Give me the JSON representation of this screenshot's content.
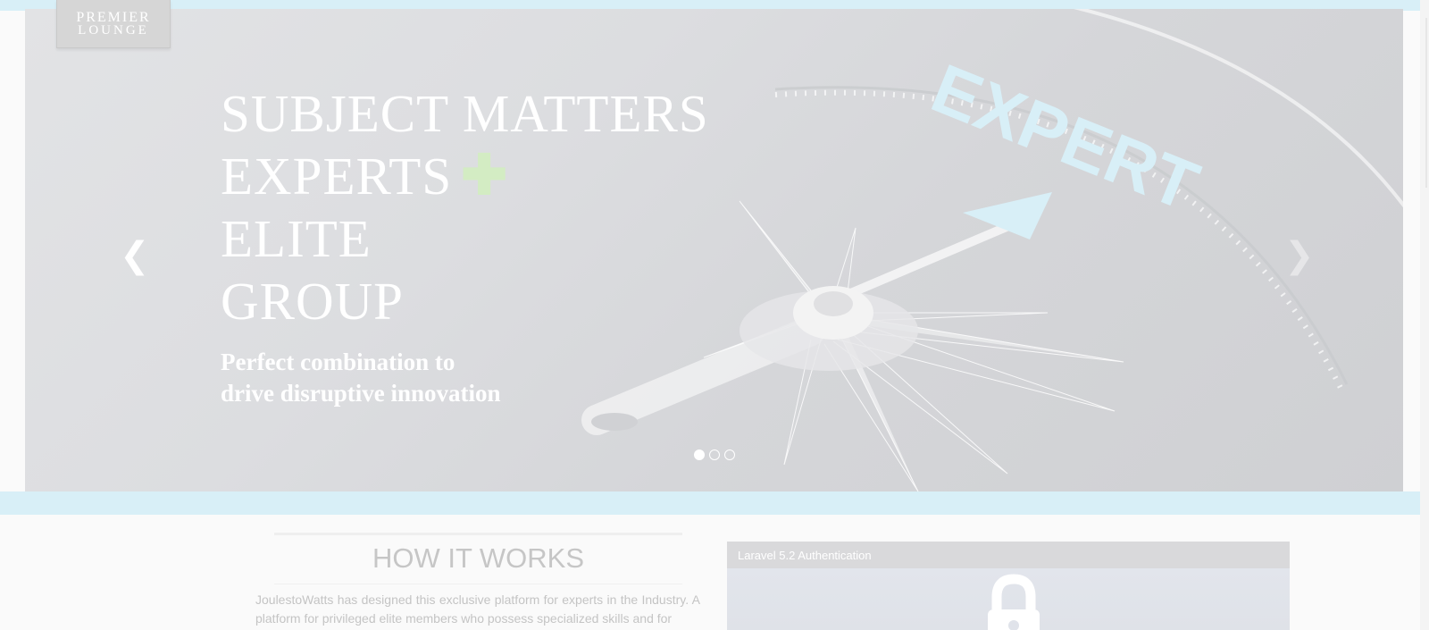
{
  "logo": {
    "line1": "PREMIER",
    "line2": "LOUNGE"
  },
  "hero": {
    "headline": [
      "SUBJECT MATTERS",
      "EXPERTS",
      "ELITE",
      "GROUP"
    ],
    "plus_symbol": "✚",
    "subheadline": [
      "Perfect combination to",
      "drive disruptive innovation"
    ],
    "background_text": "EXPERT",
    "prev_arrow_icon": "chevron-left-icon",
    "next_arrow_icon": "chevron-right-icon",
    "prev_glyph": "❮",
    "next_glyph": "❯",
    "slides_total": 3,
    "active_slide": 1,
    "accent_color": "#d3ecc3"
  },
  "how_it_works": {
    "title": "HOW IT WORKS",
    "text": "JoulestoWatts has designed this exclusive platform for experts in the Industry. A platform for privileged elite members who possess specialized skills and for"
  },
  "auth_panel": {
    "header": "Laravel 5.2 Authentication",
    "icon": "lock-icon"
  },
  "colors": {
    "strip": "#d8eff7",
    "hero_overlay": "#dcdde0"
  }
}
